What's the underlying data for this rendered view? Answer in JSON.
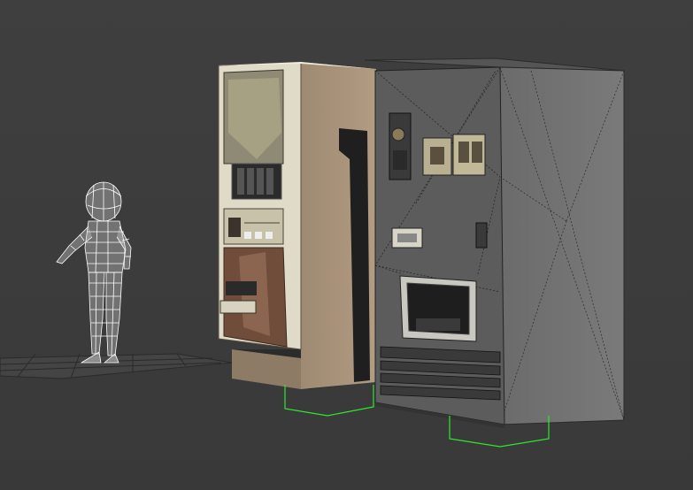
{
  "viewport": {
    "background": "#3d3d3d",
    "selection_color": "#2ee82e",
    "wire_color": "#ffffff"
  },
  "objects": [
    {
      "name": "child-character-wireframe",
      "style": "wireframe"
    },
    {
      "name": "ground-grid-plane",
      "style": "wireframe"
    },
    {
      "name": "vending-machine-textured",
      "style": "shaded"
    },
    {
      "name": "vending-machine-grey-mesh",
      "style": "shaded-with-edges"
    }
  ]
}
